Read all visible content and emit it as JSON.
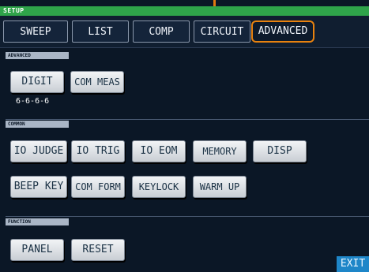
{
  "header": {
    "title": "SETUP"
  },
  "tabs": [
    {
      "label": "SWEEP",
      "active": false
    },
    {
      "label": "LIST",
      "active": false
    },
    {
      "label": "COMP",
      "active": false
    },
    {
      "label": "CIRCUIT",
      "active": false
    },
    {
      "label": "ADVANCED",
      "active": true
    }
  ],
  "sections": {
    "advanced": {
      "label": "ADVANCED",
      "buttons": [
        "DIGIT",
        "COM MEAS"
      ],
      "digit_value": "6-6-6-6"
    },
    "common": {
      "label": "COMMON",
      "row1": [
        "IO JUDGE",
        "IO TRIG",
        "IO EOM",
        "MEMORY",
        "DISP"
      ],
      "row2": [
        "BEEP KEY",
        "COM FORM",
        "KEYLOCK",
        "WARM UP"
      ]
    },
    "function": {
      "label": "FUNCTION",
      "buttons": [
        "PANEL",
        "RESET"
      ]
    }
  },
  "footer": {
    "exit_label": "EXIT"
  },
  "colors": {
    "accent": "#e8820f",
    "header": "#2fa44a",
    "exit": "#1e86c8"
  }
}
